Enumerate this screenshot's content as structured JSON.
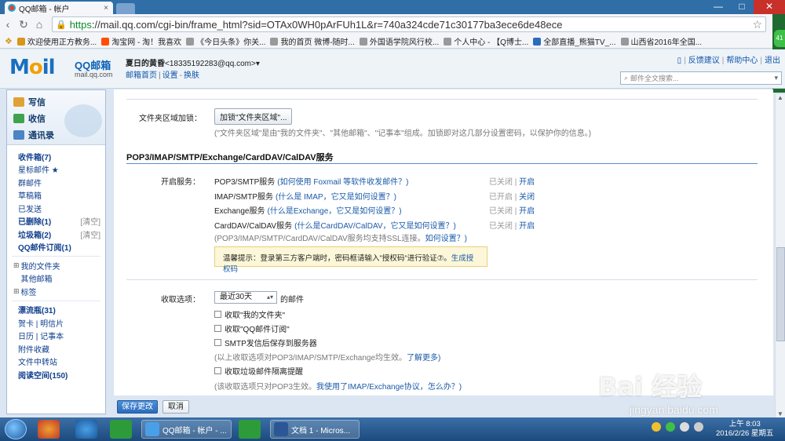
{
  "browser": {
    "tab_title": "QQ邮箱 - 帐户",
    "tab_close": "×",
    "window_buttons": [
      "—",
      "□",
      "✕"
    ],
    "url_https": "https",
    "url_rest": "://mail.qq.com/cgi-bin/frame_html?sid=OTAx0WH0pArFUh1L&r=740a324cde71c30177ba3ece6de48ece",
    "badge": "41",
    "bookmarks": [
      {
        "label": "欢迎使用正方教务...",
        "color": "#d9961a"
      },
      {
        "label": "淘宝网 - 淘！我喜欢",
        "color": "#ff5000"
      },
      {
        "label": "《今日头条》你关...",
        "color": "#999999"
      },
      {
        "label": "我的首页 微博-随时...",
        "color": "#999999"
      },
      {
        "label": "外国语学院风行校...",
        "color": "#999999"
      },
      {
        "label": "个人中心 - 【Q博士...",
        "color": "#999999"
      },
      {
        "label": "全部直播_熊猫TV_...",
        "color": "#2a6cbd"
      },
      {
        "label": "山西省2016年全国...",
        "color": "#999999"
      }
    ]
  },
  "header": {
    "logo_text": "Mail",
    "logo_cn": "QQ邮箱",
    "logo_domain": "mail.qq.com",
    "user_name": "夏日的黄昏",
    "user_email": "<18335192283@qq.com>",
    "user_links": [
      "邮箱首页",
      "设置",
      "换肤"
    ],
    "top_links": [
      "反馈建议",
      "帮助中心",
      "退出"
    ],
    "search_placeholder": "邮件全文搜索..."
  },
  "sidebar": {
    "actions": [
      "写信",
      "收信",
      "通讯录"
    ],
    "folders": [
      {
        "label": "收件箱(7)",
        "bold": true
      },
      {
        "label": "星标邮件 ★",
        "bold": false
      },
      {
        "label": "群邮件",
        "bold": false
      },
      {
        "label": "草稿箱",
        "bold": false
      },
      {
        "label": "已发送",
        "bold": false
      },
      {
        "label": "已删除(1)",
        "bold": true,
        "clear": "[清空]"
      },
      {
        "label": "垃圾箱(2)",
        "bold": true,
        "clear": "[清空]"
      },
      {
        "label": "QQ邮件订阅(1)",
        "bold": true
      }
    ],
    "groups": [
      "我的文件夹",
      "其他邮箱",
      "标签"
    ],
    "extras": [
      {
        "label": "漂流瓶(31)",
        "bold": true
      },
      {
        "label": "贺卡 | 明信片",
        "bold": false
      },
      {
        "label": "日历 | 记事本",
        "bold": false
      },
      {
        "label": "附件收藏",
        "bold": false
      },
      {
        "label": "文件中转站",
        "bold": false
      },
      {
        "label": "阅读空间(150)",
        "bold": true
      }
    ]
  },
  "main": {
    "folder_lock_label": "文件夹区域加锁：",
    "folder_lock_button": "加锁\"文件夹区域\"...",
    "folder_lock_note": "(\"文件夹区域\"是由\"我的文件夹\"、\"其他邮箱\"、\"记事本\"组成。加锁即对这几部分设置密码，以保护你的信息。)",
    "section_title": "POP3/IMAP/SMTP/Exchange/CardDAV/CalDAV服务",
    "service_label": "开启服务：",
    "services": [
      {
        "name": "POP3/SMTP服务",
        "help": "(如何使用 Foxmail 等软件收发邮件？)",
        "status": "已关闭",
        "action": "开启"
      },
      {
        "name": "IMAP/SMTP服务",
        "help": "(什么是 IMAP，它又是如何设置？)",
        "status": "已开启",
        "action": "关闭"
      },
      {
        "name": "Exchange服务",
        "help": "(什么是Exchange，它又是如何设置？)",
        "status": "已关闭",
        "action": "开启"
      },
      {
        "name": "CardDAV/CalDAV服务",
        "help": "(什么是CardDAV/CalDAV，它又是如何设置？)",
        "status": "已关闭",
        "action": "开启"
      }
    ],
    "ssl_note": "(POP3/IMAP/SMTP/CardDAV/CalDAV服务均支持SSL连接。",
    "ssl_link": "如何设置？)",
    "tip_text": "温馨提示：登录第三方客户端时，密码框请输入\"授权码\"进行验证⑦。",
    "tip_link": "生成授权码",
    "receive_label": "收取选项：",
    "receive_select": "最近30天",
    "receive_suffix": "的邮件",
    "options": [
      "收取\"我的文件夹\"",
      "收取\"QQ邮件订阅\"",
      "SMTP发信后保存到服务器"
    ],
    "options_note": "(以上收取选项对POP3/IMAP/SMTP/Exchange均生效。",
    "options_link": "了解更多)",
    "junk_option": "收取垃圾邮件隔离提醒",
    "junk_note": "(该收取选项只对POP3生效。",
    "junk_link": "我使用了IMAP/Exchange协议，怎么办？)"
  },
  "buttons": {
    "save": "保存更改",
    "cancel": "取消"
  },
  "watermark": {
    "main": "Bai 经验",
    "sub": "jingyan.baidu.com"
  },
  "taskbar": {
    "windows": [
      "QQ邮箱 - 帐户 - ...",
      "文档 1 - Micros..."
    ],
    "time": "上午 8:03",
    "date": "2016/2/26 星期五"
  }
}
